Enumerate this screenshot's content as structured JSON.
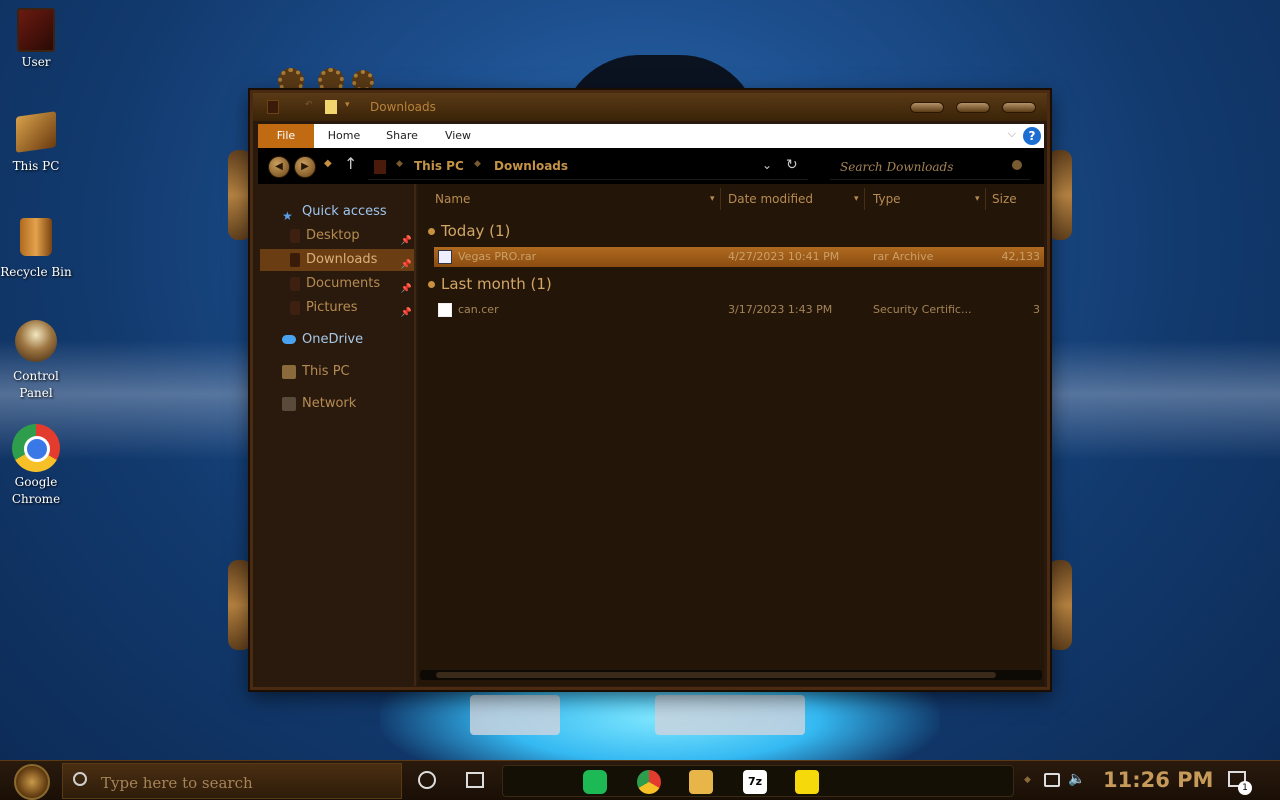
{
  "desktop": {
    "icons": [
      {
        "label": "User"
      },
      {
        "label": "This PC"
      },
      {
        "label": "Recycle Bin"
      },
      {
        "label": "Control Panel"
      },
      {
        "label": "Google Chrome"
      }
    ]
  },
  "window": {
    "title": "Downloads",
    "ribbon": {
      "tabs": [
        "File",
        "Home",
        "Share",
        "View"
      ],
      "help": "?"
    },
    "address": {
      "crumbs": [
        "This PC",
        "Downloads"
      ]
    },
    "search": {
      "placeholder": "Search Downloads"
    },
    "nav": {
      "quick_access": "Quick access",
      "items": [
        "Desktop",
        "Downloads",
        "Documents",
        "Pictures"
      ],
      "onedrive": "OneDrive",
      "this_pc": "This PC",
      "network": "Network"
    },
    "columns": [
      "Name",
      "Date modified",
      "Type",
      "Size"
    ],
    "groups": [
      {
        "title": "Today (1)",
        "files": [
          {
            "name": "Vegas PRO.rar",
            "date": "4/27/2023 10:41 PM",
            "type": "rar Archive",
            "size": "42,133"
          }
        ]
      },
      {
        "title": "Last month (1)",
        "files": [
          {
            "name": "can.cer",
            "date": "3/17/2023 1:43 PM",
            "type": "Security Certific...",
            "size": "3"
          }
        ]
      }
    ]
  },
  "taskbar": {
    "search_placeholder": "Type here to search",
    "clock": "11:26 PM",
    "apps": [
      "spotify",
      "chrome",
      "file-explorer",
      "7zip",
      "sticky-notes"
    ],
    "app_7z_label": "7z",
    "notification_count": "1"
  },
  "colors": {
    "accent": "#c06a12",
    "frame": "#2a1a0d",
    "text": "#b68b52"
  }
}
